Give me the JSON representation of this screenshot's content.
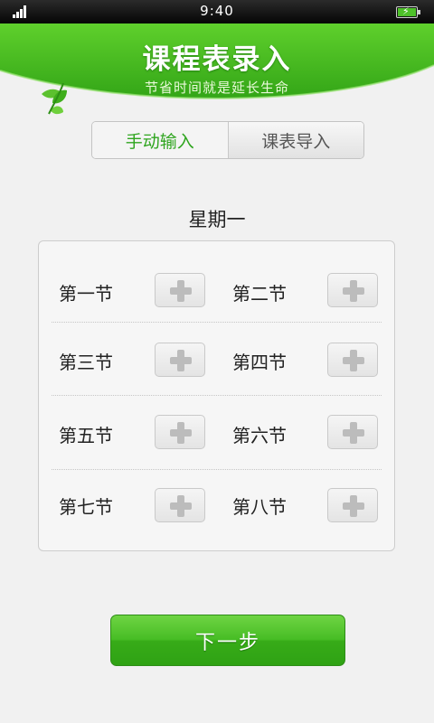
{
  "status_bar": {
    "time": "9:40",
    "icons": [
      "signal-icon",
      "battery-charging-icon"
    ]
  },
  "header": {
    "title": "课程表录入",
    "subtitle": "节省时间就是延长生命"
  },
  "tabs": [
    {
      "label": "手动输入",
      "active": true
    },
    {
      "label": "课表导入",
      "active": false
    }
  ],
  "day": "星期一",
  "slots": [
    {
      "label": "第一节"
    },
    {
      "label": "第二节"
    },
    {
      "label": "第三节"
    },
    {
      "label": "第四节"
    },
    {
      "label": "第五节"
    },
    {
      "label": "第六节"
    },
    {
      "label": "第七节"
    },
    {
      "label": "第八节"
    }
  ],
  "next_button": {
    "label": "下一步"
  },
  "colors": {
    "accent_green": "#3bb31c",
    "header_green": "#4cc11f",
    "active_tab_text": "#2fa51f"
  }
}
